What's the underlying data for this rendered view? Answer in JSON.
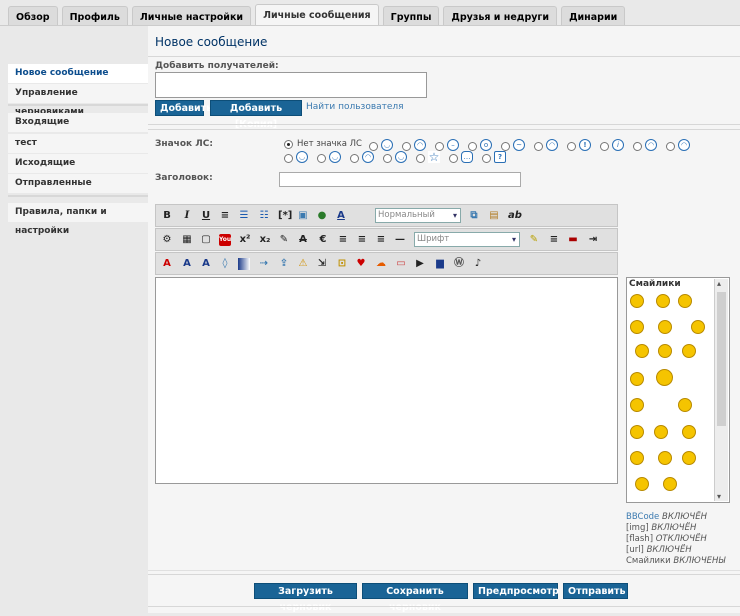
{
  "tabs": [
    "Обзор",
    "Профиль",
    "Личные настройки",
    "Личные сообщения",
    "Группы",
    "Друзья и недруги",
    "Динарии"
  ],
  "page_title": "Новое сообщение",
  "sidebar": {
    "group1": [
      "Новое сообщение",
      "Управление черновиками"
    ],
    "group2": [
      "Входящие",
      "тест",
      "Исходящие",
      "Отправленные"
    ],
    "group3": [
      "Правила, папки и настройки"
    ]
  },
  "recipients": {
    "label": "Добавить получателей:",
    "add_button": "Добавить",
    "add_copy_button": "Добавить [Копия]",
    "find_link": "Найти пользователя"
  },
  "icon": {
    "label": "Значок ЛС:",
    "none_option": "Нет значка ЛС"
  },
  "subject": {
    "label": "Заголовок:",
    "value": ""
  },
  "editor": {
    "size_select": "Нормальный",
    "font_select": "Шрифт",
    "body": ""
  },
  "smilies": {
    "title": "Смайлики"
  },
  "status": [
    {
      "label": "BBCode",
      "state": "ВКЛЮЧЁН"
    },
    {
      "label": "[img]",
      "state": "ВКЛЮЧЁН"
    },
    {
      "label": "[flash]",
      "state": "ОТКЛЮЧЁН"
    },
    {
      "label": "[url]",
      "state": "ВКЛЮЧЁН"
    },
    {
      "label": "Смайлики",
      "state": "ВКЛЮЧЕНЫ"
    }
  ],
  "footer": {
    "load_draft": "Загрузить черновик",
    "save_draft": "Сохранить черновик",
    "preview": "Предпросмотр",
    "submit": "Отправить"
  },
  "colors": {
    "button": "#1a6496",
    "active_nav": "#0d4e8e",
    "smile": "#f5c400"
  }
}
